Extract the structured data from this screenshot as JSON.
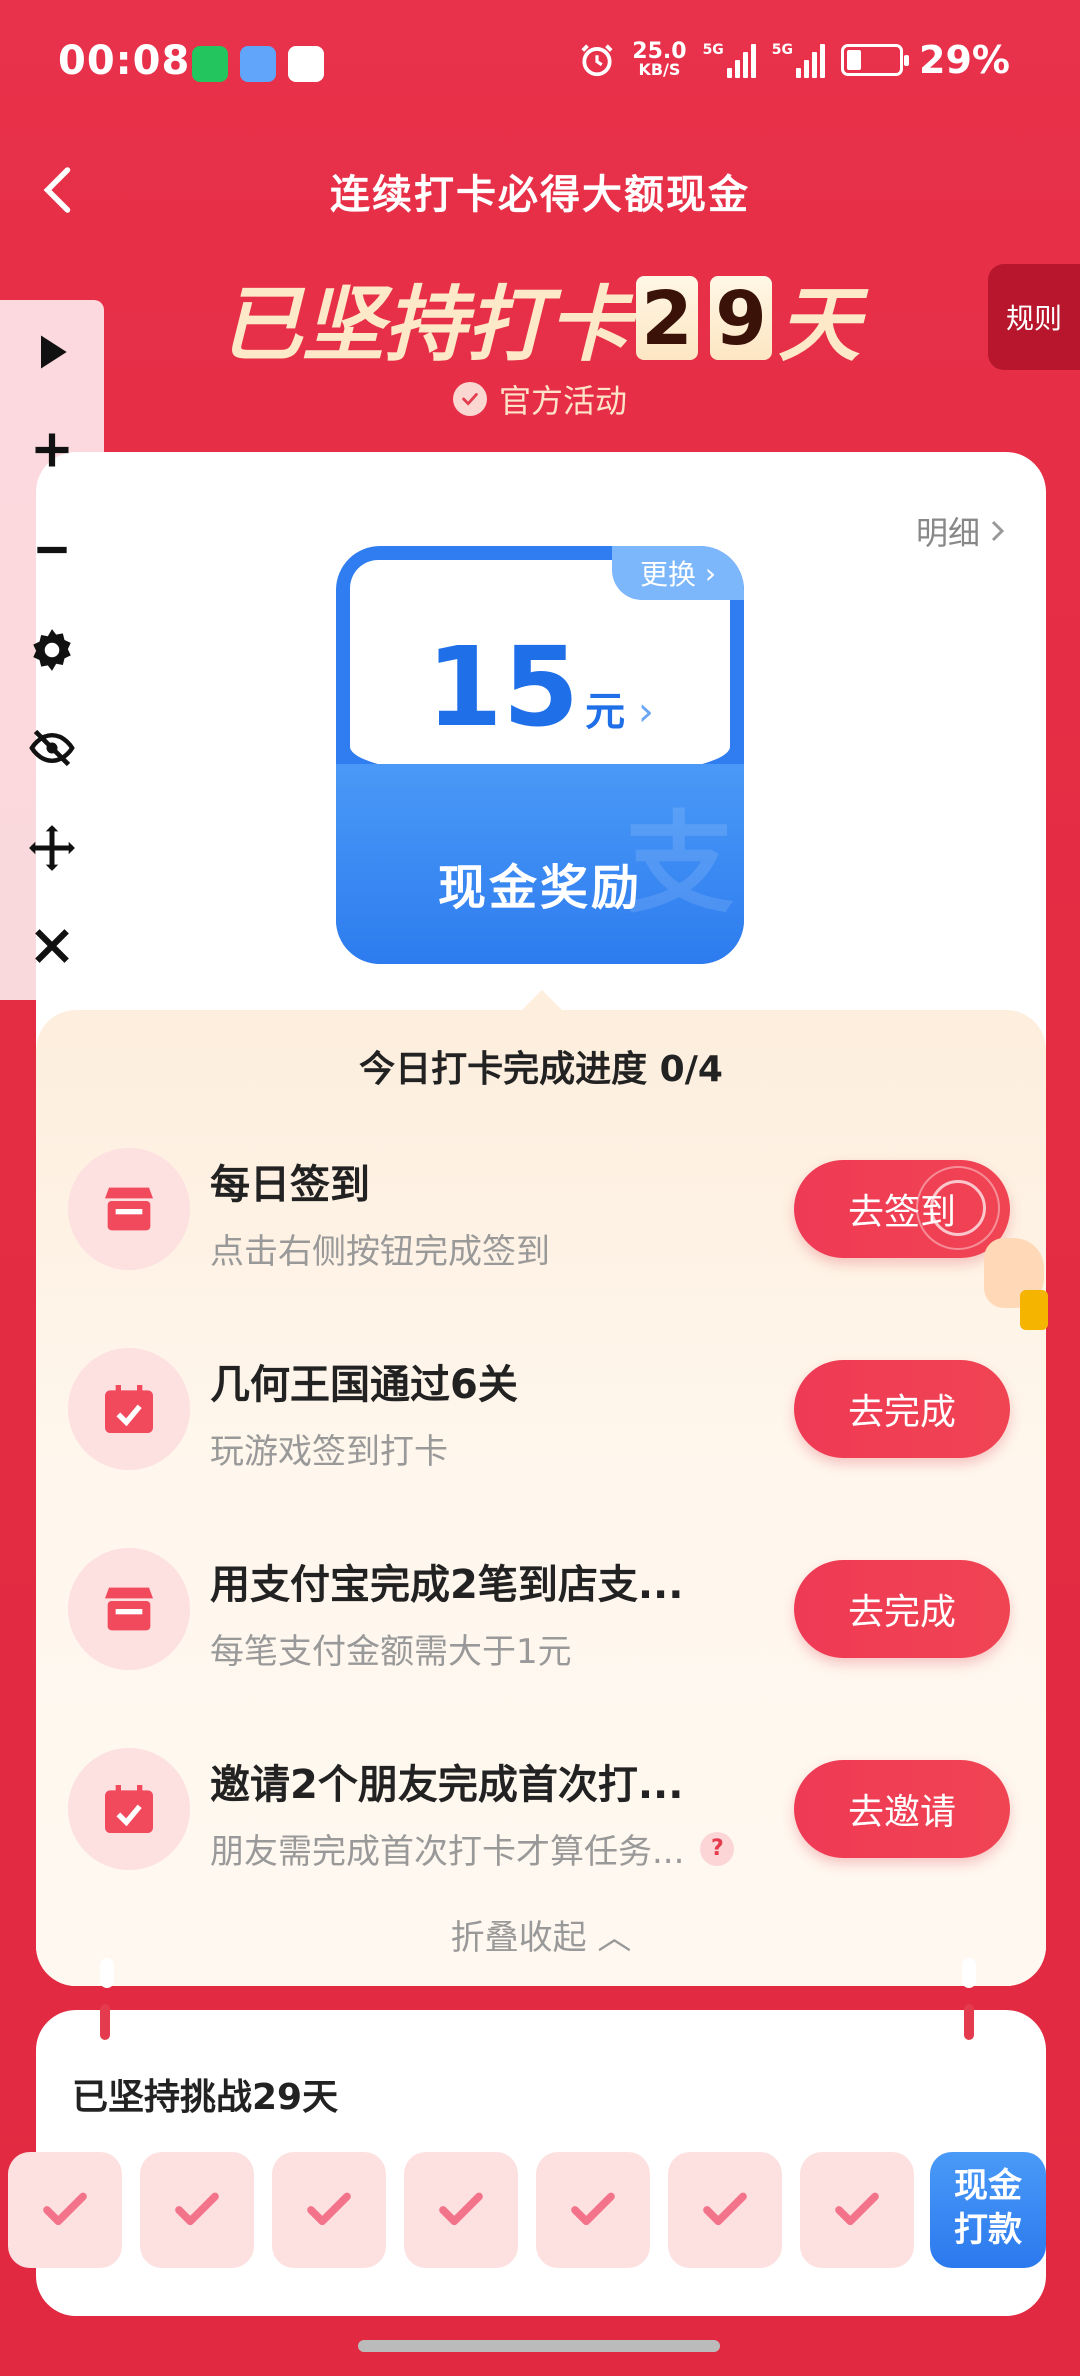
{
  "status_bar": {
    "time": "00:08",
    "net_speed_value": "25.0",
    "net_speed_unit": "KB/S",
    "sig1_label": "5G",
    "sig2_label": "5G",
    "battery_pct": "29%",
    "battery_level": 0.29
  },
  "header": {
    "title": "连续打卡必得大额现金",
    "hero_prefix": "已坚持打卡",
    "hero_digit1": "2",
    "hero_digit2": "9",
    "hero_suffix": "天",
    "official_label": "官方活动",
    "rules_label": "规则"
  },
  "toolbar_icons": [
    "play-icon",
    "plus-icon",
    "minus-icon",
    "gear-icon",
    "eye-off-icon",
    "move-icon",
    "close-icon"
  ],
  "card": {
    "detail_label": "明细",
    "reward": {
      "amount": "15",
      "unit": "元",
      "label": "现金奖励",
      "swap_label": "更换",
      "watermark": "支"
    },
    "progress_text": "今日打卡完成进度 0/4",
    "tasks": [
      {
        "title": "每日签到",
        "subtitle": "点击右侧按钮完成签到",
        "button": "去签到",
        "icon": "store-icon"
      },
      {
        "title": "几何王国通过6关",
        "subtitle": "玩游戏签到打卡",
        "button": "去完成",
        "icon": "calendar-check-icon"
      },
      {
        "title": "用支付宝完成2笔到店支...",
        "subtitle": "每笔支付金额需大于1元",
        "button": "去完成",
        "icon": "store-icon"
      },
      {
        "title": "邀请2个朋友完成首次打...",
        "subtitle": "朋友需完成首次打卡才算任务...",
        "button": "去邀请",
        "icon": "calendar-check-icon",
        "help": "?"
      }
    ],
    "collapse_label": "折叠收起"
  },
  "streak": {
    "title": "已坚持挑战29天",
    "completed_days_visible": 7,
    "payout_line1": "现金",
    "payout_line2": "打款"
  },
  "colors": {
    "background_red": "#e42c43",
    "button_red": "#ef3a55",
    "reward_blue": "#2f7df0",
    "panel_cream": "#fdeedd"
  }
}
